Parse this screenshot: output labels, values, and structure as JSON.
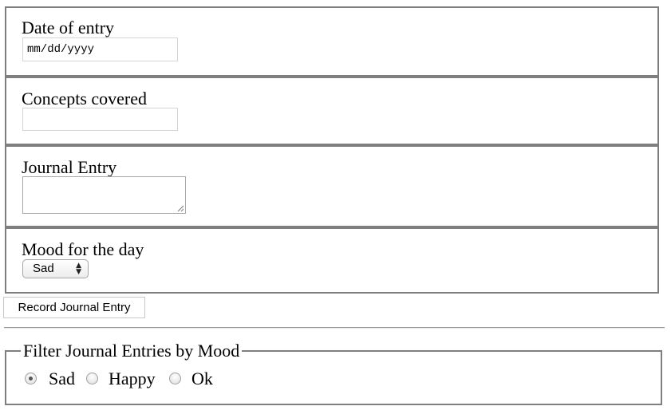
{
  "form": {
    "date": {
      "label": "Date of entry",
      "placeholder": "mm/dd/yyyy"
    },
    "concepts": {
      "label": "Concepts covered",
      "value": ""
    },
    "journal": {
      "label": "Journal Entry",
      "value": ""
    },
    "mood": {
      "label": "Mood for the day",
      "selected": "Sad"
    },
    "submit_label": "Record Journal Entry"
  },
  "filter": {
    "legend": "Filter Journal Entries by Mood",
    "options": [
      {
        "label": "Sad",
        "checked": true
      },
      {
        "label": "Happy",
        "checked": false
      },
      {
        "label": "Ok",
        "checked": false
      }
    ]
  }
}
